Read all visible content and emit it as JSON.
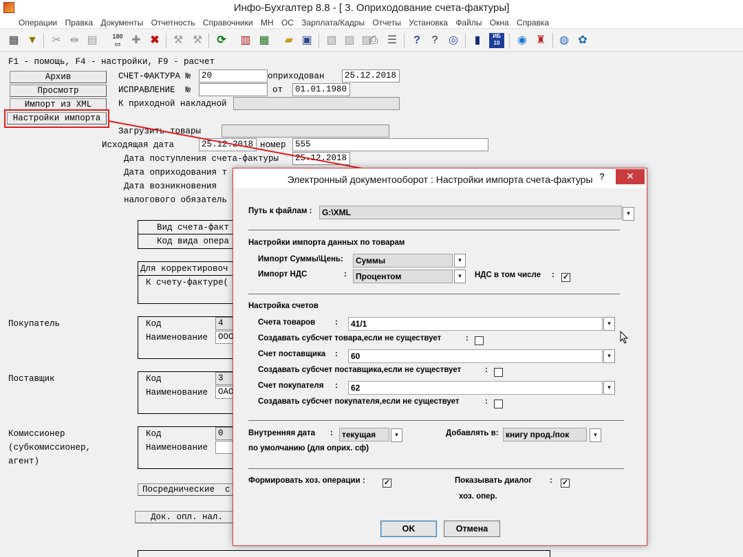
{
  "window": {
    "title": "Инфо-Бухгалтер 8.8 - [  3. Оприходование счета-фактуры]"
  },
  "menu": [
    "Операции",
    "Правка",
    "Документы",
    "Отчетность",
    "Справочники",
    "МН",
    "ОС",
    "Зарплата/Кадры",
    "Отчеты",
    "Установка",
    "Файлы",
    "Окна",
    "Справка"
  ],
  "toolbar": {
    "icons": [
      "calculator-icon",
      "filter-icon",
      "cut-icon",
      "split-icon",
      "paste-icon",
      "counter-icon",
      "add-icon",
      "delete-icon",
      "tool-icon",
      "tool2-icon",
      "refresh-icon",
      "pdf-icon",
      "spreadsheet-icon",
      "folder-icon",
      "save-icon",
      "image-icon",
      "image2-icon",
      "export-icon",
      "print-icon",
      "list-icon",
      "help-icon",
      "whats-this-icon",
      "compass-icon",
      "book-icon",
      "ib10-icon",
      "update-icon",
      "teamviewer-icon",
      "lifebuoy-icon",
      "globe-icon",
      "settings-icon"
    ],
    "ib10_label": "ИБ 10",
    "counter_label": "180"
  },
  "form": {
    "hint": "F1 - помощь, F4 - настройки, F9 - расчет",
    "buttons": {
      "archive": "Архив",
      "view": "Просмотр",
      "import_xml": "Импорт из XML",
      "import_settings": "Настройки импорта"
    },
    "invoice_label": "СЧЕТ-ФАКТУРА №",
    "invoice_no": "20",
    "posted_label": "оприходован",
    "posted_date": "25.12.2018",
    "correction_label": "ИСПРАВЛЕНИЕ  №",
    "correction_no": "",
    "from_label": "от",
    "from_date": "01.01.1980",
    "to_receipt_label": "К приходной накладной",
    "load_goods_label": "Загрузить товары",
    "outgoing_date_label": "Исходящая дата",
    "outgoing_date": "25.12.2018",
    "number_label": "номер",
    "number": "555",
    "receipt_date_label": "Дата поступления счета-фактуры",
    "receipt_date": "25.12.2018",
    "posting_date_label": "Дата оприходования т",
    "tax_date_label1": "Дата возникновения",
    "tax_date_label2": "налогового обязатель",
    "kind_label": "Вид счета-факт",
    "kind_code_label": "Код вида опера",
    "corr_label": "Для корректировоч",
    "corr_to_label": "К счету-фактуре(",
    "buyer_label": "Покупатель",
    "buyer_code": "4",
    "buyer_name": "ООО",
    "supplier_label": "Поставщик",
    "supplier_code": "3",
    "supplier_name": "ОАО",
    "commissioner_label1": "Комиссионер",
    "commissioner_label2": "(субкомиссионер,",
    "commissioner_label3": "агент)",
    "commissioner_code": "0",
    "code_label": "Код",
    "name_label": "Наименование",
    "intermediary_btn": "Посреднические  с",
    "payment_doc_btn": "Док. опл. нал."
  },
  "dialog": {
    "title": "Электронный документооборот : Настройки импорта счета-фактуры",
    "help": "?",
    "close": "✕",
    "path_label": "Путь к файлам :",
    "path_value": "G:\\XML",
    "goods_section": "Настройки импорта данных по товарам",
    "sum_price_label": "Импорт Суммы\\Цень:",
    "sum_price_value": "Суммы",
    "vat_label": "Импорт НДС",
    ":": ":",
    "vat_colon": ":",
    "vat_value": "Процентом",
    "vat_included_label": "НДС в том числе",
    "vat_included_colon": ":",
    "vat_included": true,
    "accounts_section": "Настройка счетов",
    "goods_account_label": "Счета товаров",
    "goods_account_colon": ":",
    "goods_account": "41/1",
    "create_goods_sub_label": "Создавать субсчет товара,если не существует",
    "create_goods_sub_colon": ":",
    "create_goods_sub": false,
    "supplier_account_label": "Счет поставщика",
    "supplier_account_colon": ":",
    "supplier_account": "60",
    "create_supplier_sub_label": "Создавать субсчет поставщика,если не существует",
    "create_supplier_sub_colon": ":",
    "create_supplier_sub": false,
    "buyer_account_label": "Счет покупателя",
    "buyer_account_colon": ":",
    "buyer_account": "62",
    "create_buyer_sub_label": "Создавать субсчет покупателя,если не существует",
    "create_buyer_sub_colon": ":",
    "create_buyer_sub": false,
    "internal_date_label": "Внутренняя дата",
    "internal_date_colon": ":",
    "internal_date_value": "текущая",
    "default_label": "по умолчанию (для оприх. сф)",
    "add_to_label": "Добавлять в:",
    "add_to_value": "книгу прод./пок",
    "form_ops_label": "Формировать хоз. операции :",
    "form_ops": true,
    "show_dialog_label": "Показывать диалог",
    "show_dialog_colon": ":",
    "show_dialog_label2": "хоз. опер.",
    "show_dialog": true,
    "ok": "OK",
    "cancel": "Отмена"
  },
  "colors": {
    "highlight": "#e21a1a",
    "close_button": "#c73c3c",
    "dialog_border": "#e0353a"
  }
}
